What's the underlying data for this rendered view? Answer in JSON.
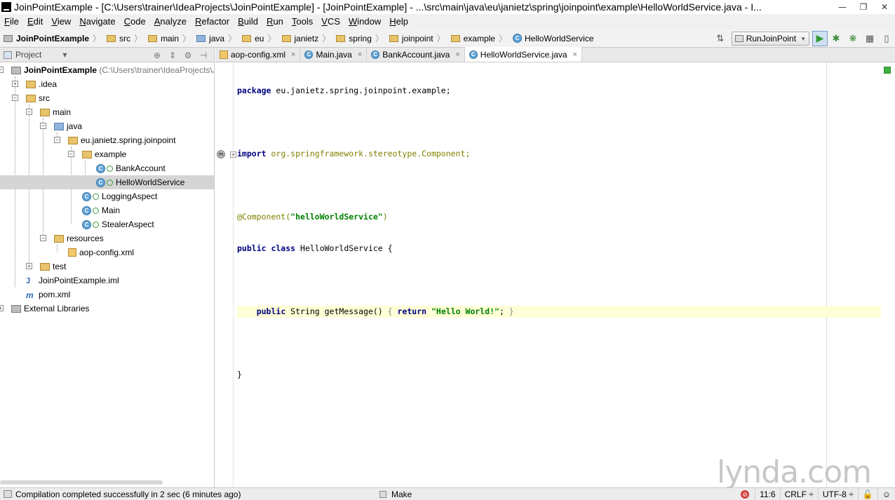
{
  "window": {
    "title": "JoinPointExample - [C:\\Users\\trainer\\IdeaProjects\\JoinPointExample] - [JoinPointExample] - ...\\src\\main\\java\\eu\\janietz\\spring\\joinpoint\\example\\HelloWorldService.java - I...",
    "minimize": "—",
    "maximize": "❐",
    "close": "✕"
  },
  "menu": [
    "File",
    "Edit",
    "View",
    "Navigate",
    "Code",
    "Analyze",
    "Refactor",
    "Build",
    "Run",
    "Tools",
    "VCS",
    "Window",
    "Help"
  ],
  "breadcrumbs": [
    "JoinPointExample",
    "src",
    "main",
    "java",
    "eu",
    "janietz",
    "spring",
    "joinpoint",
    "example",
    "HelloWorldService"
  ],
  "breadcrumb_sep": "〉",
  "run_config": {
    "label": "RunJoinPoint"
  },
  "project_panel": {
    "label": "Project"
  },
  "tabs": [
    {
      "label": "aop-config.xml",
      "type": "xml"
    },
    {
      "label": "Main.java",
      "type": "class"
    },
    {
      "label": "BankAccount.java",
      "type": "class"
    },
    {
      "label": "HelloWorldService.java",
      "type": "class",
      "active": true
    }
  ],
  "tab_close": "×",
  "tree": {
    "root_name": "JoinPointExample",
    "root_path": "(C:\\Users\\trainer\\IdeaProjects\\Jo",
    "idea": ".idea",
    "src": "src",
    "main": "main",
    "java": "java",
    "pkg": "eu.janietz.spring.joinpoint",
    "example": "example",
    "bank": "BankAccount",
    "hello": "HelloWorldService",
    "logging": "LoggingAspect",
    "main_cls": "Main",
    "stealer": "StealerAspect",
    "resources": "resources",
    "aop": "aop-config.xml",
    "test": "test",
    "iml": "JoinPointExample.iml",
    "pom": "pom.xml",
    "ext": "External Libraries"
  },
  "code": {
    "l1_kw": "package",
    "l1_rest": " eu.janietz.spring.joinpoint.example;",
    "l3_kw": "import",
    "l3_rest": " org.springframework.stereotype.Component;",
    "l5_ann": "@Component(",
    "l5_str": "\"helloWorldService\"",
    "l5_end": ")",
    "l6_kw": "public class",
    "l6_rest": " HelloWorldService {",
    "l8_kw": "public",
    "l8_mid": " String getMessage() ",
    "l8_fold1": "{ ",
    "l8_kw2": "return",
    "l8_str": "\"Hello World!\"",
    "l8_semi": "; ",
    "l8_fold2": "}",
    "l10": "}"
  },
  "watermark": "lynda.com",
  "status": {
    "message": "Compilation completed successfully in 2 sec (6 minutes ago)",
    "make": "Make",
    "position": "11:6",
    "line_sep": "CRLF ÷",
    "encoding": "UTF-8 ÷"
  }
}
